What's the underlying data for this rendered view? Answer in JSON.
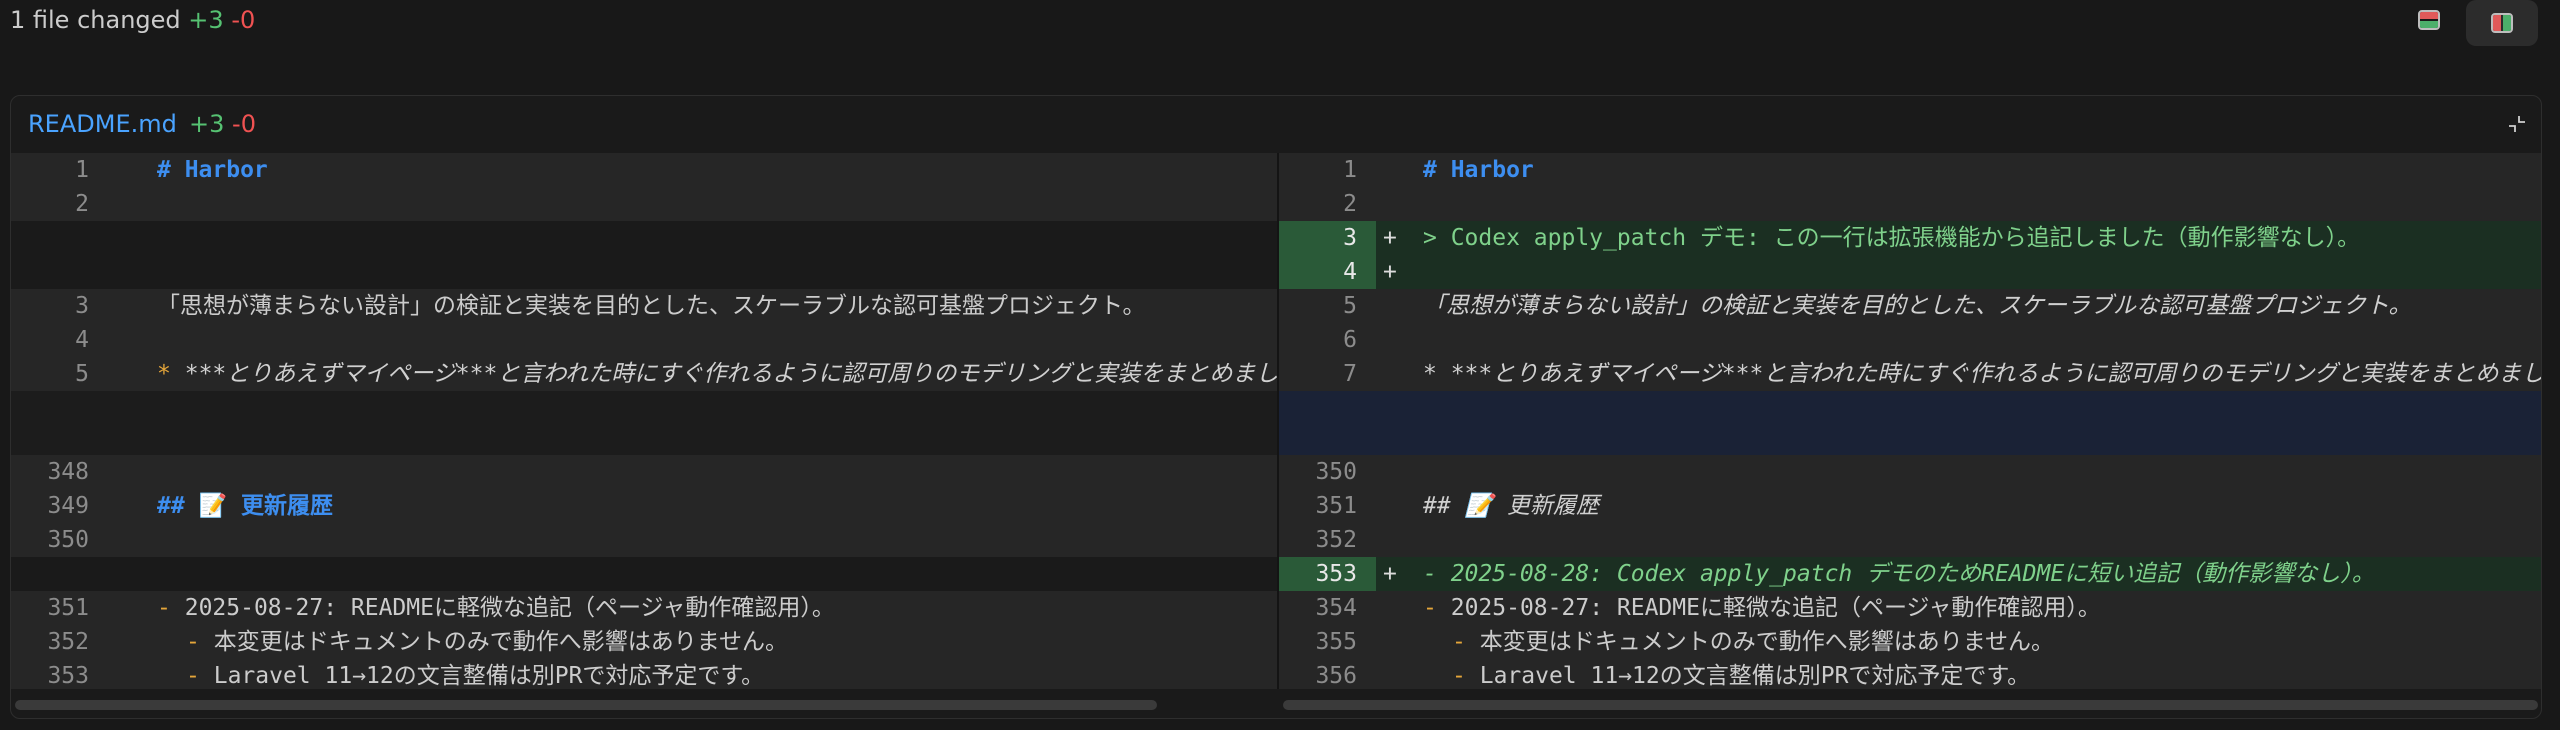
{
  "summary": {
    "files_changed": "1 file changed",
    "additions": "+3",
    "deletions": "-0"
  },
  "view_toggle": {
    "unified_icon": "unified-view-icon",
    "split_icon": "split-view-icon",
    "selected": "split"
  },
  "file": {
    "name": "README.md",
    "additions": "+3",
    "deletions": "-0",
    "collapse_icon": "collapse-icon"
  },
  "left": {
    "n1": "1",
    "l1": "# Harbor",
    "n2": "2",
    "n3": "3",
    "l3": "「思想が薄まらない設計」の検証と実装を目的とした、スケーラブルな認可基盤プロジェクト。",
    "n4": "4",
    "n5": "5",
    "l5_bullet": "*",
    "l5_text": "***とりあえずマイページ***と言われた時にすぐ作れるように認可周りのモデリングと実装をまとめました",
    "n348": "348",
    "n349": "349",
    "l349_a": "## 📝 更新履歴",
    "n350": "350",
    "n351": "351",
    "l351_bullet": "-",
    "l351_text": "2025-08-27: READMEに軽微な追記（ページャ動作確認用）。",
    "n352": "352",
    "l352_bullet": "-",
    "l352_text": "本変更はドキュメントのみで動作へ影響はありません。",
    "n353": "353",
    "l353_bullet": "-",
    "l353_text": "Laravel 11→12の文言整備は別PRで対応予定です。"
  },
  "right": {
    "n1": "1",
    "l1": "# Harbor",
    "n2": "2",
    "n3": "3",
    "m3": "+",
    "l3": "> Codex apply_patch デモ: この一行は拡張機能から追記しました（動作影響なし）。",
    "n4": "4",
    "m4": "+",
    "n5": "5",
    "l5": "「思想が薄まらない設計」の検証と実装を目的とした、スケーラブルな認可基盤プロジェクト。",
    "n6": "6",
    "n7": "7",
    "l7": "* ***とりあえずマイページ***と言われた時にすぐ作れるように認可周りのモデリングと実装をまとめました",
    "n350": "350",
    "n351": "351",
    "l351": "## 📝 更新履歴",
    "n352": "352",
    "n353": "353",
    "m353": "+",
    "l353": "- 2025-08-28: Codex apply_patch デモのためREADMEに短い追記（動作影響なし）。",
    "n354": "354",
    "l354_bullet": "-",
    "l354_text": "2025-08-27: READMEに軽微な追記（ページャ動作確認用）。",
    "n355": "355",
    "l355_bullet": "-",
    "l355_text": "本変更はドキュメントのみで動作へ影響はありません。",
    "n356": "356",
    "l356_bullet": "-",
    "l356_text": "Laravel 11→12の文言整備は別PRで対応予定です。"
  }
}
